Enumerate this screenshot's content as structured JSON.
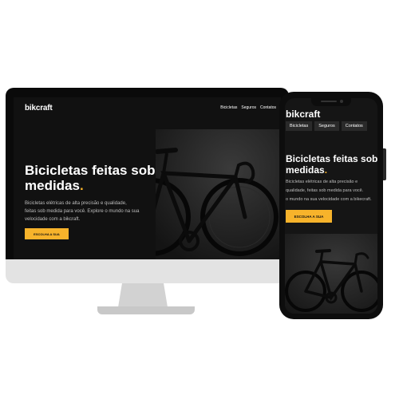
{
  "brand": "bikcraft",
  "nav": [
    "Bicicletas",
    "Seguros",
    "Contatos"
  ],
  "hero": {
    "title_text": "Bicicletas feitas sob medidas",
    "title_accent": ".",
    "description_lines": [
      "Bicicletas elétricas de alta precisão e qualidade,",
      "feitas sob medida para você. Explore o mundo na sua",
      "velocidade com a bikcraft."
    ],
    "mobile_description_lines": [
      "Bicicletas elétricas de alta precisão e",
      "qualidade, feitas sob medida para você.",
      "o mundo na sua velocidade com a bikecraft."
    ],
    "cta_label": "ESCOLHA A SUA"
  },
  "colors": {
    "accent": "#f7b32b",
    "background": "#111111",
    "device_frame": "#0a0a0a"
  },
  "icons": {
    "hero_image": "bicycle-photo"
  }
}
